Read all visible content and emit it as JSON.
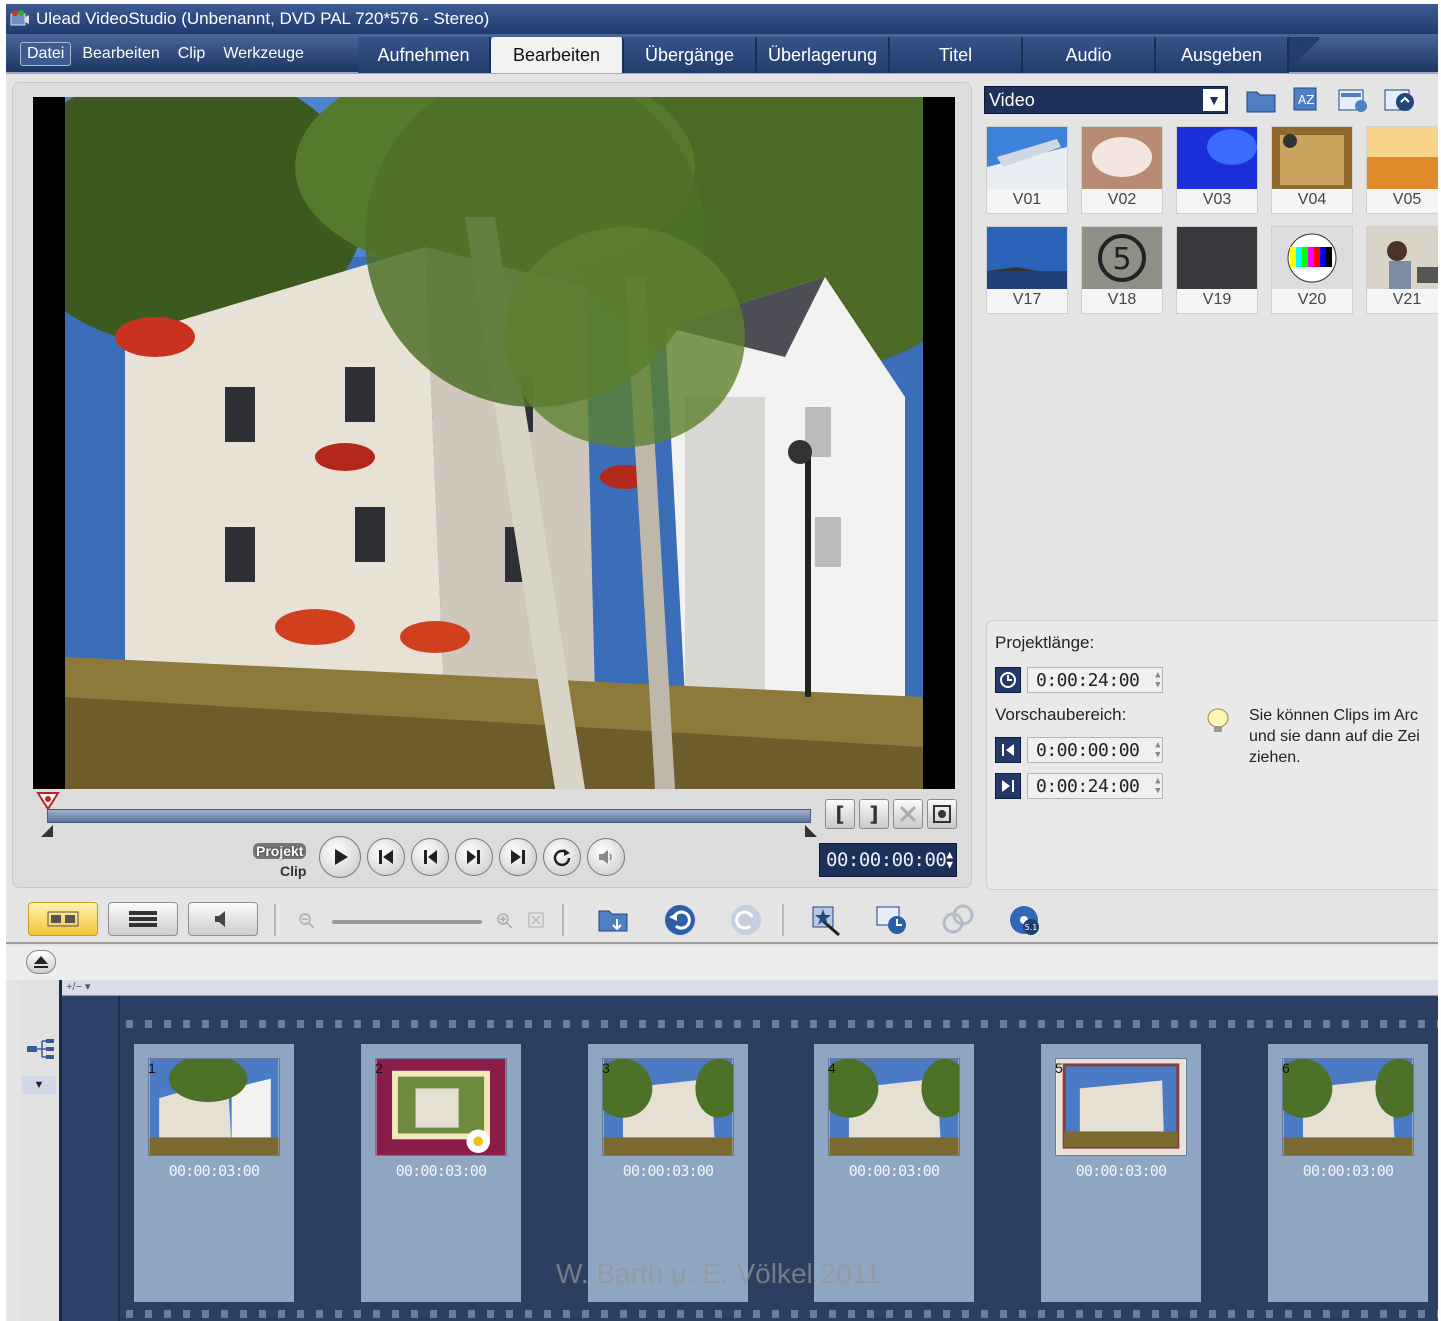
{
  "window": {
    "title": "Ulead VideoStudio (Unbenannt, DVD PAL 720*576 - Stereo)"
  },
  "menu": [
    "Datei",
    "Bearbeiten",
    "Clip",
    "Werkzeuge"
  ],
  "tabs": [
    "Aufnehmen",
    "Bearbeiten",
    "Übergänge",
    "Überlagerung",
    "Titel",
    "Audio",
    "Ausgeben"
  ],
  "active_tab": "Bearbeiten",
  "preview": {
    "mode_projekt": "Projekt",
    "mode_clip": "Clip",
    "timecode": "00:00:00:00",
    "mark_in": "[",
    "mark_out": "]"
  },
  "library": {
    "category": "Video",
    "thumbs": [
      "V01",
      "V02",
      "V03",
      "V04",
      "V05",
      "V17",
      "V18",
      "V19",
      "V20",
      "V21"
    ],
    "v18_digit": "5"
  },
  "info": {
    "projektlaenge_label": "Projektlänge:",
    "projektlaenge_value": "0:00:24:00",
    "vorschau_label": "Vorschaubereich:",
    "vorschau_start": "0:00:00:00",
    "vorschau_end": "0:00:24:00",
    "hint_line1": "Sie können Clips im Arc",
    "hint_line2": "und sie dann auf die Zei",
    "hint_line3": "ziehen."
  },
  "timeline": {
    "ruler_label": "+/− ▾",
    "clips": [
      {
        "num": "1",
        "tc": "00:00:03:00"
      },
      {
        "num": "2",
        "tc": "00:00:03:00"
      },
      {
        "num": "3",
        "tc": "00:00:03:00"
      },
      {
        "num": "4",
        "tc": "00:00:03:00"
      },
      {
        "num": "5",
        "tc": "00:00:03:00"
      },
      {
        "num": "6",
        "tc": "00:00:03:00"
      }
    ]
  },
  "watermark": "W. Barth u. E. Völkel 2011",
  "colors": {
    "accent": "#1d3059",
    "titlebar": "#2b4a80",
    "timeline": "#2c3f62",
    "clip": "#8fa6c2",
    "active_view": "#f3c43a"
  }
}
